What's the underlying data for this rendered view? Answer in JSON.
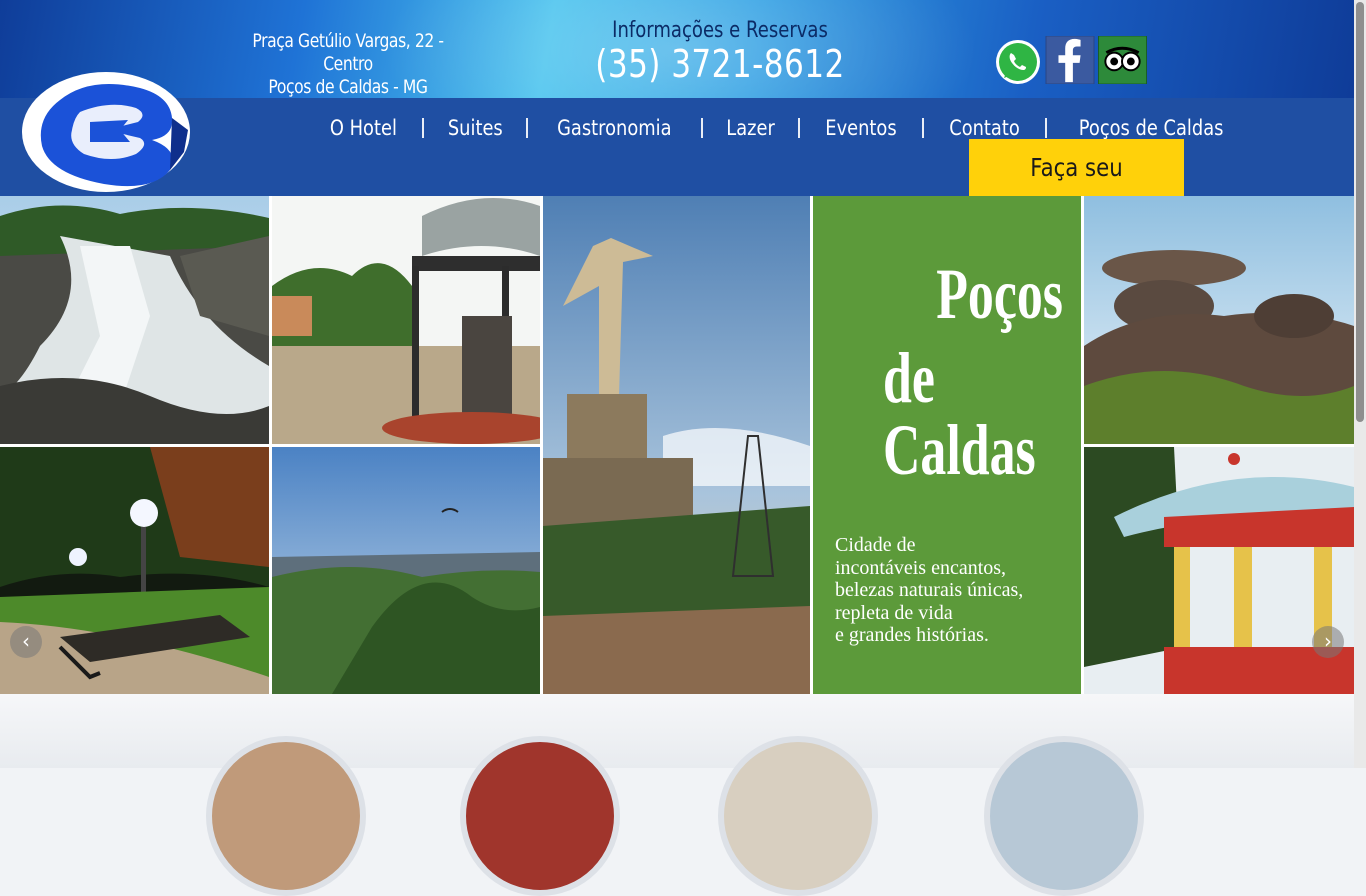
{
  "header": {
    "address_line1": "Praça Getúlio Vargas, 22 - Centro",
    "address_line2": "Poços de Caldas - MG",
    "info_label": "Informações e Reservas",
    "phone": "(35) 3721-8612",
    "social_icons": [
      "whatsapp-icon",
      "facebook-icon",
      "tripadvisor-icon"
    ],
    "logo_icon": "hotel-logo-icon"
  },
  "nav": {
    "items": [
      "O Hotel",
      "Suites",
      "Gastronomia",
      "Lazer",
      "Eventos",
      "Contato",
      "Poços de Caldas"
    ],
    "quote_button": "Faça seu Orçamento"
  },
  "banner": {
    "title_line1": "Poços",
    "title_line2": "de Caldas",
    "caption_line1": "Cidade de",
    "caption_line2": "incontáveis encantos,",
    "caption_line3": "belezas naturais únicas,",
    "caption_line4": "repleta de vida",
    "caption_line5": "e grandes histórias.",
    "prev_arrow": "‹",
    "next_arrow": "›"
  },
  "colors": {
    "nav_band": "#1f4fa3",
    "quote_button": "#ffd10a",
    "banner_green": "#5c9a3a"
  }
}
